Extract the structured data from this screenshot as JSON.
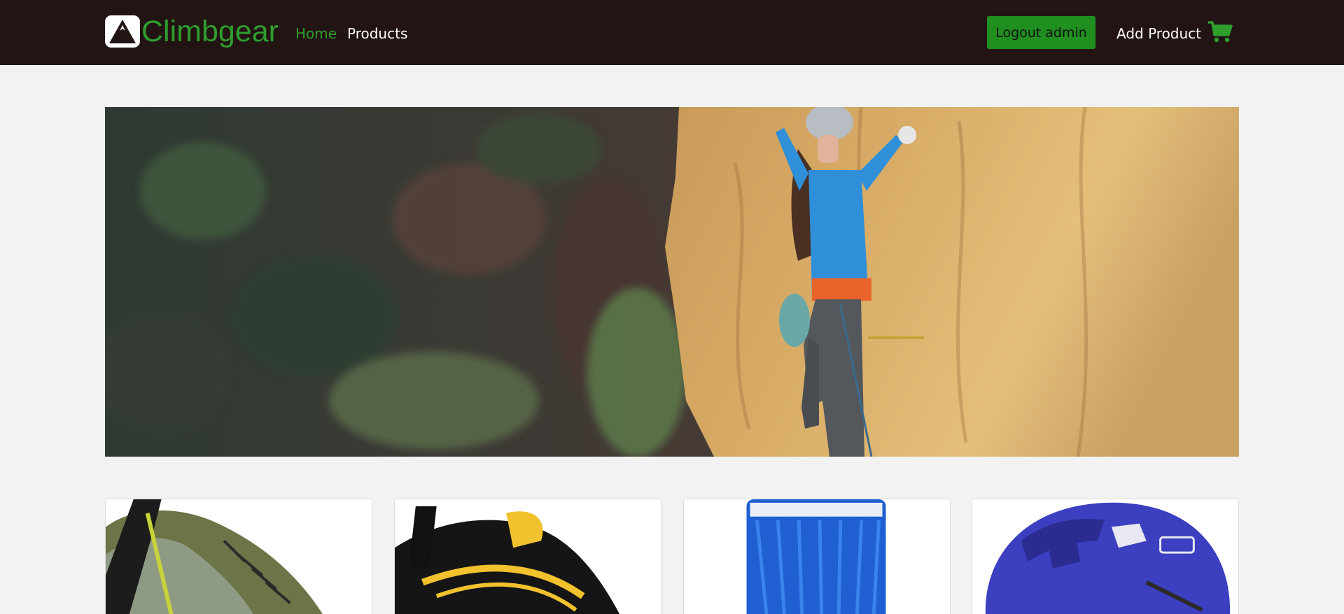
{
  "navbar": {
    "brand": "Climbgear",
    "links": {
      "home": "Home",
      "products": "Products"
    },
    "logout_label": "Logout admin",
    "add_product_label": "Add Product",
    "icons": {
      "logo": "mountain-logo-icon",
      "cart": "shopping-cart-icon"
    }
  },
  "hero": {
    "image": "rock-climber-hero-image"
  },
  "products": [
    {
      "image": "olive-climbing-shoe-image"
    },
    {
      "image": "black-yellow-climbing-shoe-image"
    },
    {
      "image": "blue-climbing-rope-image"
    },
    {
      "image": "blue-petzl-helmet-image"
    }
  ],
  "colors": {
    "navbar_bg": "#231414",
    "brand_green": "#2e9e2e",
    "button_green": "#1f8f1f",
    "page_bg": "#f2f2f2"
  }
}
